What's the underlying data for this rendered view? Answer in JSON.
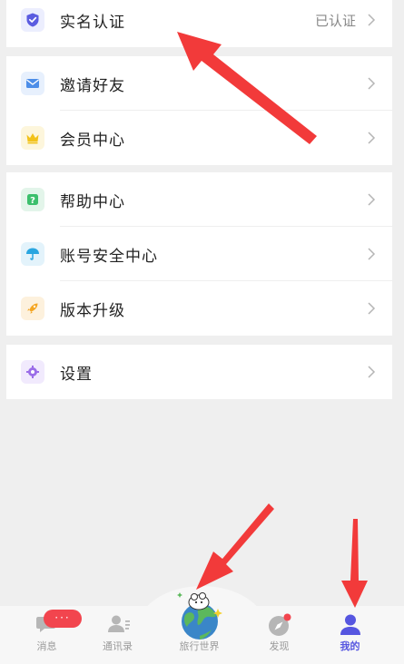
{
  "groups": [
    {
      "items": [
        {
          "id": "realname",
          "label": "实名认证",
          "value": "已认证",
          "icon": "shield-check-icon",
          "icon_bg": "#eceefe",
          "icon_color": "#5b5ce0"
        }
      ]
    },
    {
      "items": [
        {
          "id": "invite",
          "label": "邀请好友",
          "icon": "mail-icon",
          "icon_bg": "#e7f0fd",
          "icon_color": "#4d8ee8"
        },
        {
          "id": "vip",
          "label": "会员中心",
          "icon": "crown-icon",
          "icon_bg": "#fdf6dc",
          "icon_color": "#f2c21b"
        }
      ]
    },
    {
      "items": [
        {
          "id": "help",
          "label": "帮助中心",
          "icon": "help-icon",
          "icon_bg": "#e3f5ea",
          "icon_color": "#3cbf6c"
        },
        {
          "id": "security",
          "label": "账号安全中心",
          "icon": "umbrella-icon",
          "icon_bg": "#e3f3fb",
          "icon_color": "#2aa6e0"
        },
        {
          "id": "upgrade",
          "label": "版本升级",
          "icon": "rocket-icon",
          "icon_bg": "#fdf1dd",
          "icon_color": "#f4a623"
        }
      ]
    },
    {
      "items": [
        {
          "id": "settings",
          "label": "设置",
          "icon": "gear-icon",
          "icon_bg": "#f1eafd",
          "icon_color": "#9b6ee8"
        }
      ]
    }
  ],
  "tabbar": {
    "messages": "消息",
    "contacts": "通讯录",
    "travel": "旅行世界",
    "discover": "发现",
    "mine": "我的",
    "badge": "···"
  },
  "colors": {
    "accent": "#5656e0",
    "badge": "#f2454e",
    "arrow": "#f23a3a"
  }
}
